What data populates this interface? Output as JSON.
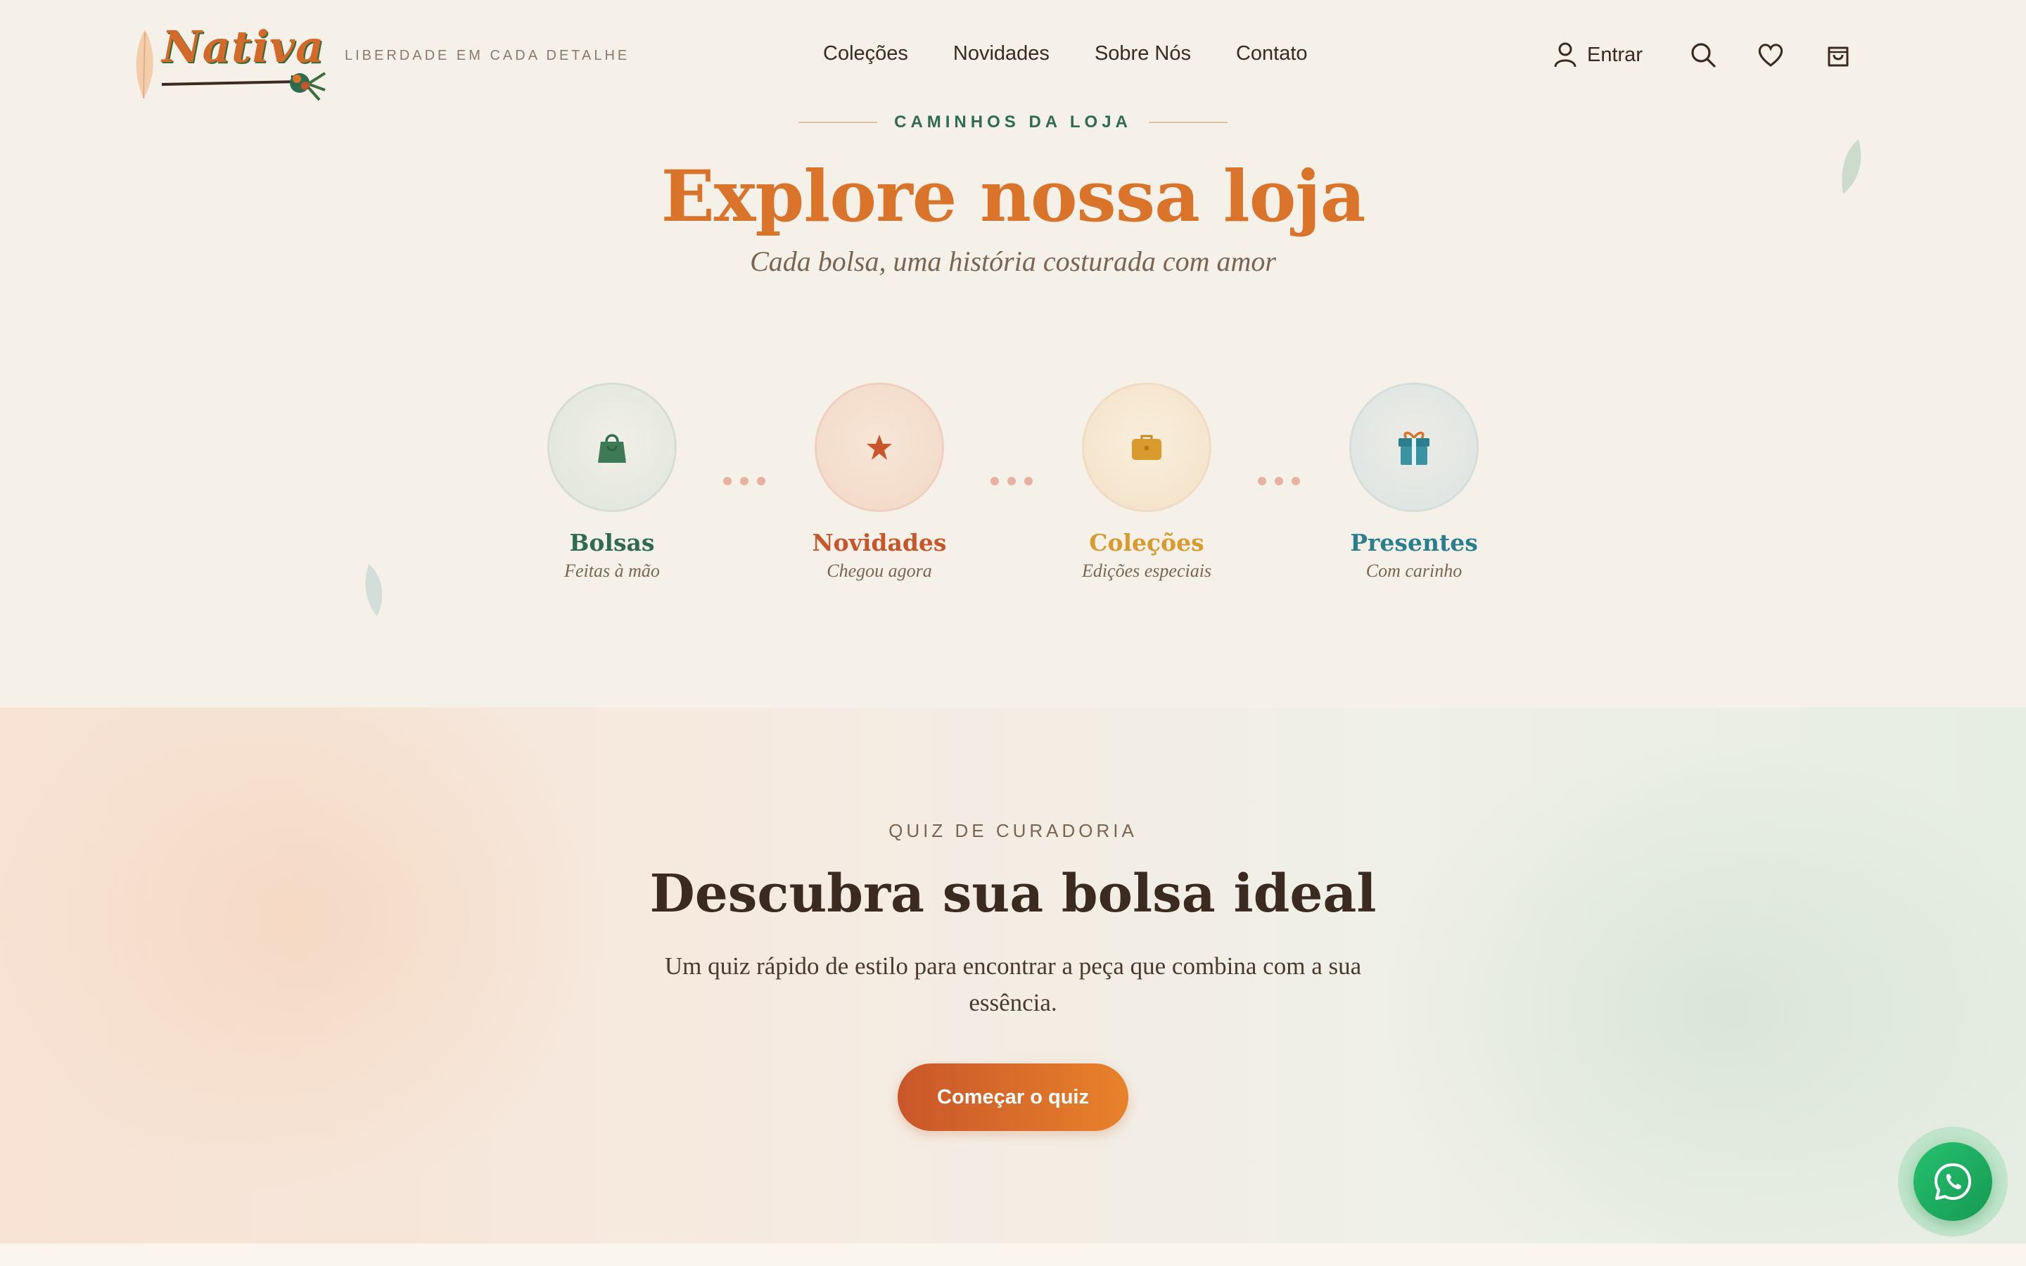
{
  "header": {
    "logo_text": "Nativa",
    "tagline": "LIBERDADE EM CADA DETALHE",
    "nav": [
      "Coleções",
      "Novidades",
      "Sobre Nós",
      "Contato"
    ],
    "login_label": "Entrar",
    "icons": [
      "user-icon",
      "search-icon",
      "heart-icon",
      "shopping-bag-icon"
    ]
  },
  "explore": {
    "eyebrow": "CAMINHOS DA LOJA",
    "title": "Explore nossa loja",
    "subtitle": "Cada bolsa, uma história costurada com amor",
    "paths": [
      {
        "title": "Bolsas",
        "desc": "Feitas à mão",
        "icon": "handbag-icon",
        "color": "#2f6b4f"
      },
      {
        "title": "Novidades",
        "desc": "Chegou agora",
        "icon": "star-icon",
        "color": "#c9562a"
      },
      {
        "title": "Coleções",
        "desc": "Edições especiais",
        "icon": "briefcase-icon",
        "color": "#d99a2e"
      },
      {
        "title": "Presentes",
        "desc": "Com carinho",
        "icon": "gift-icon",
        "color": "#2a7f8f"
      }
    ]
  },
  "quiz": {
    "eyebrow": "QUIZ DE CURADORIA",
    "title": "Descubra sua bolsa ideal",
    "text": "Um quiz rápido de estilo para encontrar a peça que combina com a sua essência.",
    "button": "Começar o quiz"
  },
  "floating": {
    "whatsapp_icon": "whatsapp-icon",
    "whatsapp_color": "#25c16f"
  },
  "colors": {
    "background": "#f5f0e8",
    "accent_orange": "#d9742a",
    "accent_green": "#2f6b4f"
  }
}
